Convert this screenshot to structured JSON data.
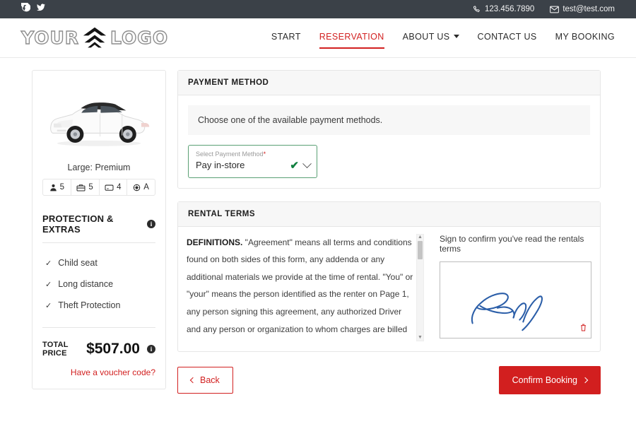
{
  "topbar": {
    "social": [
      {
        "name": "facebook-icon",
        "label": "Facebook"
      },
      {
        "name": "twitter-icon",
        "label": "Twitter"
      }
    ],
    "phone": "123.456.7890",
    "email": "test@test.com"
  },
  "header": {
    "logo_left": "YOUR",
    "logo_right": "LOGO",
    "nav": [
      {
        "label": "START",
        "active": false,
        "caret": false
      },
      {
        "label": "RESERVATION",
        "active": true,
        "caret": false
      },
      {
        "label": "ABOUT US",
        "active": false,
        "caret": true
      },
      {
        "label": "CONTACT US",
        "active": false,
        "caret": false
      },
      {
        "label": "MY BOOKING",
        "active": false,
        "caret": false
      }
    ]
  },
  "sidebar": {
    "car_title": "Large: Premium",
    "specs": [
      {
        "icon": "passengers-icon",
        "value": "5"
      },
      {
        "icon": "luggage-icon",
        "value": "5"
      },
      {
        "icon": "doors-icon",
        "value": "4"
      },
      {
        "icon": "transmission-icon",
        "value": "A"
      }
    ],
    "protection_title": "PROTECTION & EXTRAS",
    "info_glyph": "i",
    "extras": [
      {
        "label": "Child seat"
      },
      {
        "label": "Long distance"
      },
      {
        "label": "Theft Protection"
      }
    ],
    "total_label": "TOTAL PRICE",
    "total_value": "$507.00",
    "voucher_link": "Have a voucher code?"
  },
  "payment": {
    "card_title": "PAYMENT METHOD",
    "notice": "Choose one of the available payment methods.",
    "select_label": "Select Payment Method",
    "select_required_mark": "*",
    "select_value": "Pay in-store",
    "valid_mark": "✔"
  },
  "rental_terms": {
    "card_title": "RENTAL TERMS",
    "lead": "DEFINITIONS.",
    "body": " \"Agreement\" means all terms and conditions found on both sides of this form, any addenda or any additional materials we provide at the time of rental. \"You\" or \"your\" means the person identified as the renter on Page 1, any person signing this agreement, any authorized Driver and any person or organization to whom charges are billed by us on the renter's direction. All persons referred to as \"you\" or \"your\" are jointly and severally bound by this agreement. \"We,\" \"our\" or \"us\" means the Rental Agent identified on",
    "scroll_up": "▲",
    "scroll_down": "▼",
    "sign_prompt": "Sign to confirm you've read the rentals terms",
    "clear_icon": "trash-icon"
  },
  "actions": {
    "back_label": "Back",
    "confirm_label": "Confirm Booking"
  },
  "colors": {
    "brand_red": "#d21f1f",
    "topbar_dark": "#3b4148",
    "valid_green": "#5aa074",
    "signature_blue": "#2b5ea8"
  }
}
